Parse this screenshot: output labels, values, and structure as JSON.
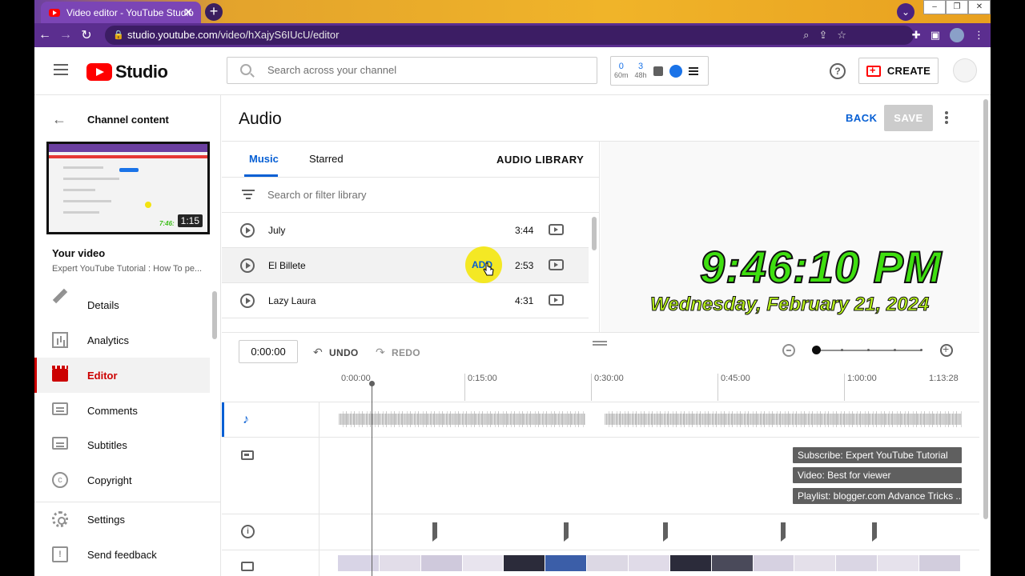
{
  "browser": {
    "tab_title": "Video editor - YouTube Studio",
    "tab_close": "✕",
    "new_tab": "+",
    "url_host": "studio.youtube.com",
    "url_path": "/video/hXajyS6IUcU/editor",
    "win_min": "–",
    "win_restore": "❐",
    "win_close": "✕"
  },
  "header": {
    "logo_text": "Studio",
    "search_placeholder": "Search across your channel",
    "counters": [
      {
        "value": "0",
        "unit": "60m"
      },
      {
        "value": "3",
        "unit": "48h"
      }
    ],
    "create_label": "CREATE",
    "help_glyph": "?"
  },
  "leftnav": {
    "back_label": "Channel content",
    "thumbnail_duration": "1:15",
    "thumbnail_clock": "7:46:",
    "your_video_label": "Your video",
    "video_title": "Expert YouTube Tutorial : How To pe...",
    "items": [
      {
        "label": "Details",
        "icon": "pencil-icon",
        "active": false
      },
      {
        "label": "Analytics",
        "icon": "analytics-icon",
        "active": false
      },
      {
        "label": "Editor",
        "icon": "editor-icon",
        "active": true
      },
      {
        "label": "Comments",
        "icon": "comments-icon",
        "active": false
      },
      {
        "label": "Subtitles",
        "icon": "subtitles-icon",
        "active": false
      },
      {
        "label": "Copyright",
        "icon": "copyright-icon",
        "active": false
      }
    ],
    "settings_label": "Settings",
    "feedback_label": "Send feedback"
  },
  "main": {
    "title": "Audio",
    "back_label": "BACK",
    "save_label": "SAVE",
    "tabs": {
      "music": "Music",
      "starred": "Starred",
      "audio_library": "AUDIO LIBRARY"
    },
    "filter_placeholder": "Search or filter library",
    "tracks": [
      {
        "name": "July",
        "duration": "3:44"
      },
      {
        "name": "El Billete",
        "duration": "2:53",
        "add_label": "ADD"
      },
      {
        "name": "Lazy Laura",
        "duration": "4:31"
      }
    ],
    "preview_clock": {
      "time": "9:46:10 PM",
      "date": "Wednesday, February 21, 2024"
    }
  },
  "timeline": {
    "timecode": "0:00:00",
    "undo_label": "UNDO",
    "redo_label": "REDO",
    "ruler_ticks": [
      "0:00:00",
      "0:15:00",
      "0:30:00",
      "0:45:00",
      "1:00:00",
      "1:13:28"
    ],
    "endscreen_elements": [
      "Subscribe: Expert YouTube Tutorial",
      "Video: Best for viewer",
      "Playlist: blogger.com Advance Tricks ..."
    ],
    "info_glyph": "i"
  }
}
